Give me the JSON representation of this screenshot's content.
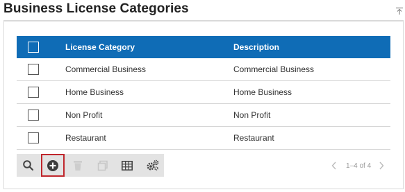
{
  "page": {
    "title": "Business License Categories"
  },
  "grid": {
    "columns": {
      "category": "License Category",
      "description": "Description"
    },
    "rows": [
      {
        "category": "Commercial Business",
        "description": "Commercial Business"
      },
      {
        "category": "Home Business",
        "description": "Home Business"
      },
      {
        "category": "Non Profit",
        "description": "Non Profit"
      },
      {
        "category": "Restaurant",
        "description": "Restaurant"
      }
    ]
  },
  "toolbar": {
    "buttons": [
      {
        "icon": "search-icon"
      },
      {
        "icon": "add-circle-icon",
        "selected": true
      },
      {
        "icon": "trash-icon",
        "disabled": true
      },
      {
        "icon": "copy-icon",
        "disabled": true
      },
      {
        "icon": "table-icon"
      },
      {
        "icon": "settings-icon"
      }
    ]
  },
  "pager": {
    "info": "1–4 of 4"
  },
  "colors": {
    "header": "#0f6cb6",
    "toolbar": "#e3e3e3",
    "highlight": "#c0262c"
  }
}
